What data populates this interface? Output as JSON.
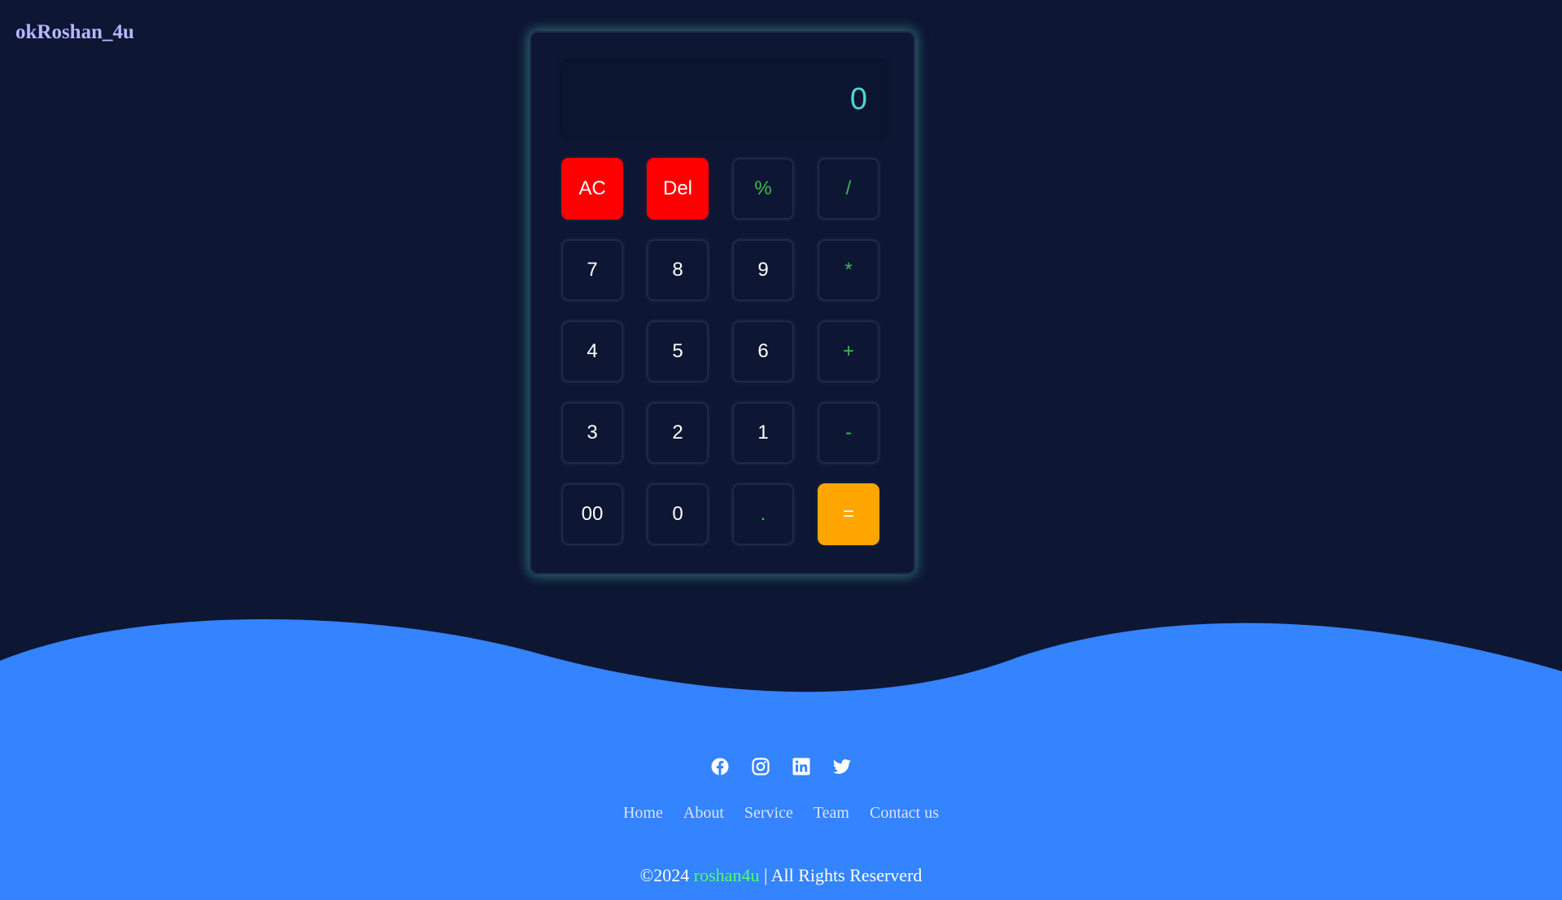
{
  "brand": {
    "name": "okRoshan_4u"
  },
  "display": {
    "value": "0"
  },
  "keys": [
    {
      "label": "AC",
      "kind": "red",
      "name": "all-clear-button"
    },
    {
      "label": "Del",
      "kind": "red",
      "name": "delete-button"
    },
    {
      "label": "%",
      "kind": "op",
      "name": "percent-button"
    },
    {
      "label": "/",
      "kind": "op",
      "name": "divide-button"
    },
    {
      "label": "7",
      "kind": "num",
      "name": "digit-7-button"
    },
    {
      "label": "8",
      "kind": "num",
      "name": "digit-8-button"
    },
    {
      "label": "9",
      "kind": "num",
      "name": "digit-9-button"
    },
    {
      "label": "*",
      "kind": "op",
      "name": "multiply-button"
    },
    {
      "label": "4",
      "kind": "num",
      "name": "digit-4-button"
    },
    {
      "label": "5",
      "kind": "num",
      "name": "digit-5-button"
    },
    {
      "label": "6",
      "kind": "num",
      "name": "digit-6-button"
    },
    {
      "label": "+",
      "kind": "op",
      "name": "add-button"
    },
    {
      "label": "3",
      "kind": "num",
      "name": "digit-3-button"
    },
    {
      "label": "2",
      "kind": "num",
      "name": "digit-2-button"
    },
    {
      "label": "1",
      "kind": "num",
      "name": "digit-1-button"
    },
    {
      "label": "-",
      "kind": "op",
      "name": "subtract-button"
    },
    {
      "label": "00",
      "kind": "num",
      "name": "double-zero-button"
    },
    {
      "label": "0",
      "kind": "num",
      "name": "digit-0-button"
    },
    {
      "label": ".",
      "kind": "op",
      "name": "decimal-button"
    },
    {
      "label": "=",
      "kind": "eq",
      "name": "equals-button"
    }
  ],
  "social": [
    {
      "icon": "facebook-icon"
    },
    {
      "icon": "instagram-icon"
    },
    {
      "icon": "linkedin-icon"
    },
    {
      "icon": "twitter-icon"
    }
  ],
  "nav": {
    "links": [
      {
        "label": "Home"
      },
      {
        "label": "About"
      },
      {
        "label": "Service"
      },
      {
        "label": "Team"
      },
      {
        "label": "Contact us"
      }
    ]
  },
  "footer": {
    "prefix": "©2024 ",
    "highlight": "roshan4u",
    "suffix": " | All Rights Reserverd"
  },
  "colors": {
    "background": "#0d1633",
    "footer": "#3483ff",
    "accent_red": "#ff0000",
    "accent_orange": "#ffa500",
    "operator_green": "#3fb950",
    "display_text": "#4fd4d0",
    "brand_text": "#b7b7ff",
    "footer_highlight": "#4cff6b"
  }
}
